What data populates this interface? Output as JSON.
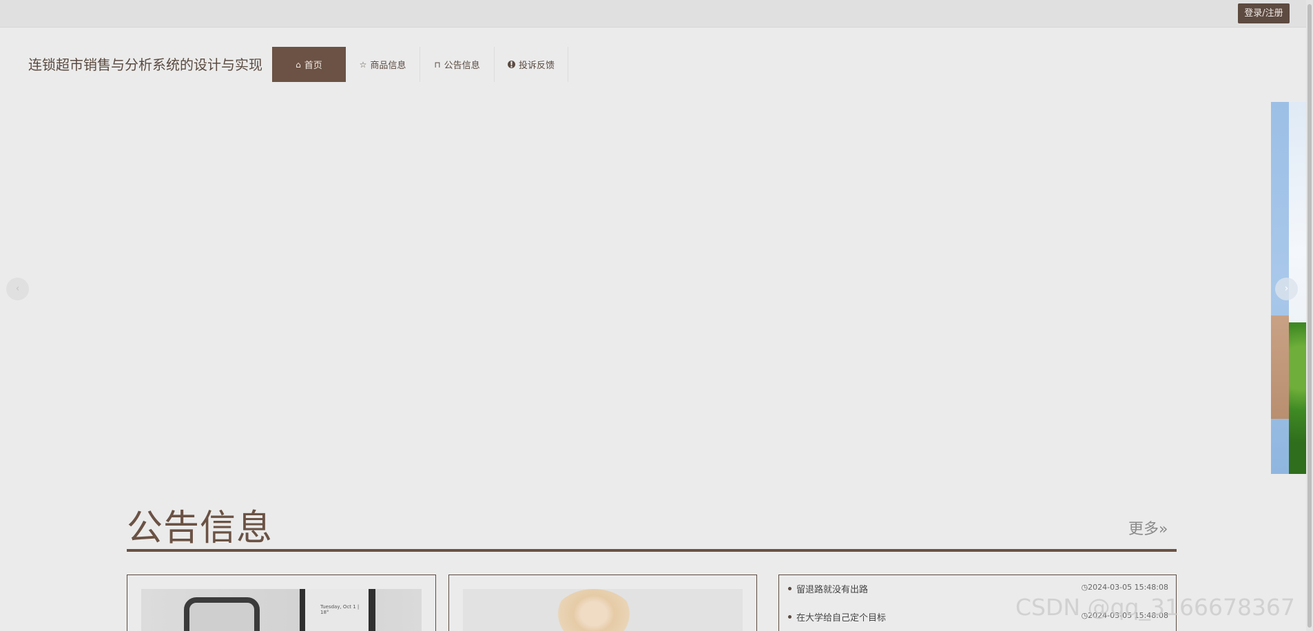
{
  "topbar": {
    "login_label": "登录/注册"
  },
  "site": {
    "title": "连锁超市销售与分析系统的设计与实现"
  },
  "nav": {
    "items": [
      {
        "label": "首页",
        "icon": "home-icon",
        "active": true
      },
      {
        "label": "商品信息",
        "icon": "star-icon",
        "active": false
      },
      {
        "label": "公告信息",
        "icon": "bag-icon",
        "active": false
      },
      {
        "label": "投诉反馈",
        "icon": "alert-icon",
        "active": false
      }
    ]
  },
  "carousel": {
    "prev_icon": "chevron-left-icon",
    "next_icon": "chevron-right-icon",
    "prev_glyph": "‹",
    "next_glyph": "›"
  },
  "notices": {
    "title": "公告信息",
    "more_label": "更多»",
    "phone_text": "Tuesday, Oct 1 | 18°",
    "items": [
      {
        "text": "留退路就没有出路",
        "time": "◷2024-03-05 15:48:08"
      },
      {
        "text": "在大学给自己定个目标",
        "time": "◷2024-03-05 15:48:08"
      }
    ]
  },
  "watermark": "CSDN @qq_3166678367",
  "colors": {
    "accent": "#6b5244",
    "background": "#ebebeb",
    "topbar": "#e0e0e0"
  }
}
